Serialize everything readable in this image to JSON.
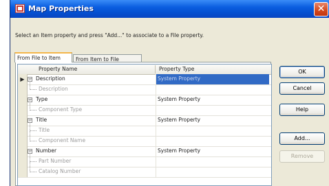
{
  "window": {
    "title": "Map Properties",
    "close_label": "✕"
  },
  "instruction": "Select an Item property and press \"Add...\" to associate to a File property.",
  "tabs": [
    "From File to Item",
    "From Item to File"
  ],
  "grid": {
    "columns": [
      "Property Name",
      "Property Type"
    ],
    "rows": [
      {
        "name": "Description",
        "type": "System Property",
        "level": 0,
        "expander": "−",
        "selected": true,
        "current": true
      },
      {
        "name": "Description",
        "type": "",
        "level": 1
      },
      {
        "name": "Type",
        "type": "System Property",
        "level": 0,
        "expander": "−"
      },
      {
        "name": "Component Type",
        "type": "",
        "level": 1
      },
      {
        "name": "Title",
        "type": "System Property",
        "level": 0,
        "expander": "−"
      },
      {
        "name": "Title",
        "type": "",
        "level": 1
      },
      {
        "name": "Component Name",
        "type": "",
        "level": 1
      },
      {
        "name": "Number",
        "type": "System Property",
        "level": 0,
        "expander": "−"
      },
      {
        "name": "Part Number",
        "type": "",
        "level": 1
      },
      {
        "name": "Catalog Number",
        "type": "",
        "level": 1
      }
    ]
  },
  "buttons": {
    "ok": "OK",
    "cancel": "Cancel",
    "help": "Help",
    "add": "Add...",
    "remove": "Remove"
  },
  "current_row_marker": "▶",
  "colors": {
    "selection": "#316ac5",
    "titlebar": "#0550d0",
    "dialog_face": "#ece9d8"
  }
}
